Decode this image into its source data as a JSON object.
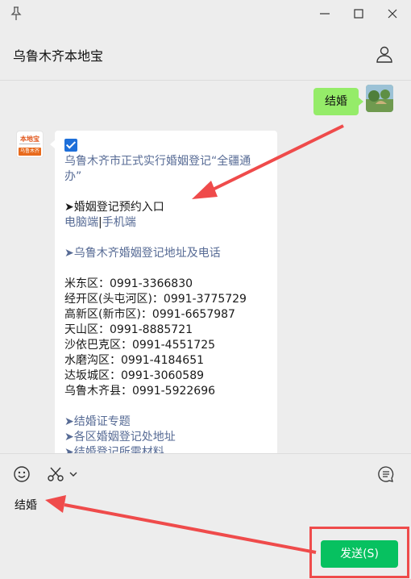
{
  "window": {
    "title": "乌鲁木齐本地宝",
    "buttons": [
      "pin-icon",
      "minimize-icon",
      "maximize-icon",
      "close-icon"
    ]
  },
  "header": {
    "title": "乌鲁木齐本地宝",
    "right_icon": "person-icon"
  },
  "chat": {
    "my_message": "结婚",
    "bot_avatar": {
      "logo_top": "本地宝",
      "logo_bottom": "乌鲁木齐"
    },
    "reply": {
      "intro": "乌鲁木齐市正式实行婚姻登记“全疆通办”",
      "booking_title": "➤婚姻登记预约入口",
      "booking_links": [
        "电脑端",
        "手机端"
      ],
      "address_title": "➤乌鲁木齐婚姻登记地址及电话",
      "phones": [
        "米东区：0991-3366830",
        "经开区(头屯河区)：0991-3775729",
        "高新区(新市区)：0991-6657987",
        "天山区：0991-8885721",
        "沙依巴克区：0991-4551725",
        "水磨沟区：0991-4184651",
        "达坂城区：0991-3060589",
        "乌鲁木齐县：0991-5922696"
      ],
      "more_links": [
        "➤结婚证专题",
        "➤各区婚姻登记处地址",
        "➤结婚登记所需材料"
      ]
    }
  },
  "input": {
    "toolbar_icons": [
      "emoji-icon",
      "scissors-icon",
      "chevron-down-icon",
      "chat-history-icon"
    ],
    "text": "结婚",
    "send_label": "发送(S)"
  },
  "colors": {
    "my_bubble": "#95ec69",
    "send_button": "#07c160",
    "link": "#576b95",
    "annotation": "#ef4b4b"
  }
}
